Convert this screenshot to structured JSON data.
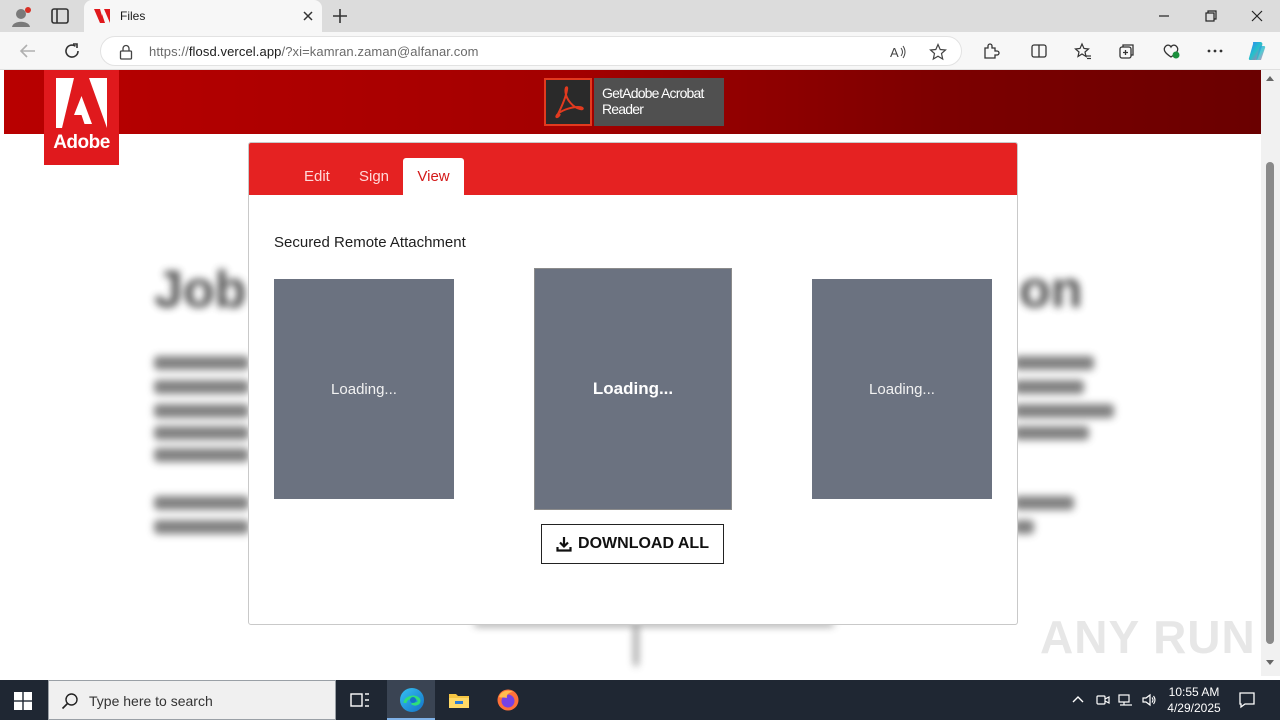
{
  "browser": {
    "tab_title": "Files",
    "url_prefix": "https://",
    "url_host": "flosd.vercel.app",
    "url_path": "/?xi=kamran.zaman@alfanar.com"
  },
  "banner": {
    "brand": "Adobe",
    "get_reader": "GetAdobe Acrobat Reader"
  },
  "modal": {
    "tabs": [
      {
        "label": "Edit"
      },
      {
        "label": "Sign"
      },
      {
        "label": "View"
      }
    ],
    "active_tab": "View",
    "heading": "Secured Remote Attachment",
    "previews": [
      {
        "label": "Loading..."
      },
      {
        "label": "Loading..."
      },
      {
        "label": "Loading..."
      }
    ],
    "download_label": "DOWNLOAD ALL"
  },
  "background_article": {
    "title_left": "Job",
    "title_right": "on"
  },
  "watermark": "ANY RUN",
  "taskbar": {
    "search_placeholder": "Type here to search",
    "time": "10:55 AM",
    "date": "4/29/2025"
  },
  "colors": {
    "accent_red": "#e52222",
    "banner_dark": "#6a0000",
    "preview_gray": "#6b7280"
  }
}
